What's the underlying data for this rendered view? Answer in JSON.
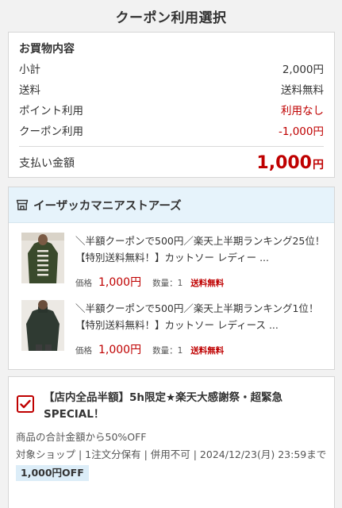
{
  "page": {
    "title": "クーポン利用選択"
  },
  "summary": {
    "heading": "お買物内容",
    "rows": [
      {
        "label": "小計",
        "value": "2,000円"
      },
      {
        "label": "送料",
        "value": "送料無料"
      },
      {
        "label": "ポイント利用",
        "value": "利用なし"
      },
      {
        "label": "クーポン利用",
        "value": "-1,000円"
      }
    ],
    "total_label": "支払い金額",
    "total_amount": "1,000",
    "total_unit": "円"
  },
  "shop": {
    "name": "イーザッカマニアストアーズ",
    "icon": "shop-icon",
    "items": [
      {
        "title": "＼半額クーポンで500円／楽天上半期ランキング25位！【特別送料無料！】カットソー レディー ...",
        "price_label": "価格",
        "price": "1,000円",
        "qty": "数量：1",
        "shipping": "送料無料"
      },
      {
        "title": "＼半額クーポンで500円／楽天上半期ランキング1位！【特別送料無料！】カットソー レディース ...",
        "price_label": "価格",
        "price": "1,000円",
        "qty": "数量：1",
        "shipping": "送料無料"
      }
    ]
  },
  "coupon": {
    "checked": true,
    "title": "【店内全品半額】5h限定★楽天大感謝祭・超緊急SPECIAL！",
    "description": "商品の合計金額から50%OFF",
    "meta": "対象ショップ | 1注文分保有 | 併用不可 | 2024/12/23(月) 23:59まで",
    "discount": "1,000円OFF"
  },
  "colors": {
    "accent_red": "#bf0000",
    "shop_header_bg": "#e6f3fb",
    "discount_bg": "#dcedf8"
  }
}
